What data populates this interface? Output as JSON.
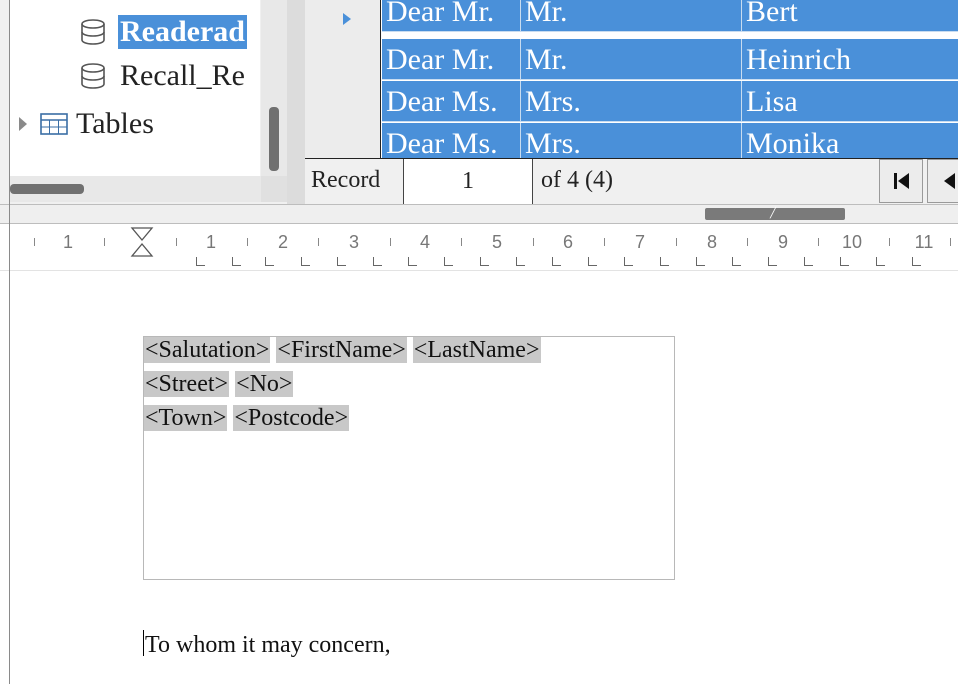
{
  "tree": {
    "items": [
      {
        "label": "Readerad",
        "icon": "database-icon",
        "selected": true
      },
      {
        "label": "Recall_Re",
        "icon": "database-icon",
        "selected": false
      },
      {
        "label": "Tables",
        "icon": "table-icon",
        "selected": false
      }
    ]
  },
  "grid": {
    "rows": [
      {
        "salutation": "Dear Mr.",
        "title": "Mr.",
        "firstname": "Bert"
      },
      {
        "salutation": "Dear Mr.",
        "title": "Mr.",
        "firstname": "Heinrich"
      },
      {
        "salutation": "Dear Ms.",
        "title": "Mrs.",
        "firstname": "Lisa"
      },
      {
        "salutation": "Dear Ms.",
        "title": "Mrs.",
        "firstname": "Monika"
      }
    ]
  },
  "record_bar": {
    "label": "Record",
    "current": "1",
    "of_text": "of 4 (4)"
  },
  "ruler": {
    "labels": [
      "1",
      "1",
      "2",
      "3",
      "4",
      "5",
      "6",
      "7",
      "8",
      "9",
      "10",
      "11"
    ]
  },
  "document": {
    "address_lines": [
      [
        "<Salutation>",
        "<FirstName>",
        "<LastName>"
      ],
      [
        "<Street>",
        "<No>"
      ],
      [
        "<Town>",
        "<Postcode>"
      ]
    ],
    "body_text": "To whom it may concern,"
  },
  "colors": {
    "selection": "#4a90d9",
    "field_shading": "#c8c8c8"
  }
}
